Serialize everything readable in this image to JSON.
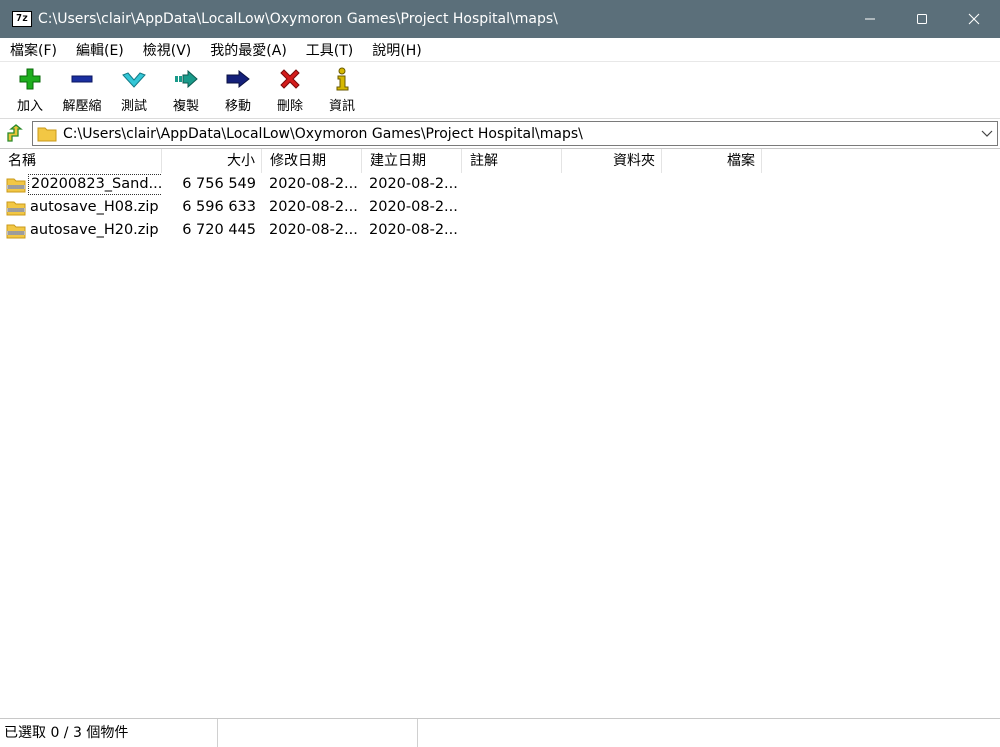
{
  "window": {
    "app_icon_text": "7z",
    "title": "C:\\Users\\clair\\AppData\\LocalLow\\Oxymoron Games\\Project Hospital\\maps\\"
  },
  "menu": [
    {
      "label": "檔案(F)"
    },
    {
      "label": "編輯(E)"
    },
    {
      "label": "檢視(V)"
    },
    {
      "label": "我的最愛(A)"
    },
    {
      "label": "工具(T)"
    },
    {
      "label": "說明(H)"
    }
  ],
  "toolbar": [
    {
      "label": "加入",
      "icon": "plus-icon",
      "color": "#1fae1f"
    },
    {
      "label": "解壓縮",
      "icon": "minus-icon",
      "color": "#1a2fa0"
    },
    {
      "label": "測試",
      "icon": "check-icon",
      "color": "#33c6d6"
    },
    {
      "label": "複製",
      "icon": "copy-arrow-icon",
      "color": "#1a9a8a"
    },
    {
      "label": "移動",
      "icon": "move-arrow-icon",
      "color": "#14207a"
    },
    {
      "label": "刪除",
      "icon": "delete-x-icon",
      "color": "#d41c1c"
    },
    {
      "label": "資訊",
      "icon": "info-icon",
      "color": "#d6b800"
    }
  ],
  "address": {
    "path": "C:\\Users\\clair\\AppData\\LocalLow\\Oxymoron Games\\Project Hospital\\maps\\"
  },
  "columns": {
    "name": "名稱",
    "size": "大小",
    "modified": "修改日期",
    "created": "建立日期",
    "comment": "註解",
    "folders": "資料夾",
    "files": "檔案"
  },
  "files": [
    {
      "name": "20200823_Sand...",
      "size": "6 756 549",
      "modified": "2020-08-2...",
      "created": "2020-08-2..."
    },
    {
      "name": "autosave_H08.zip",
      "size": "6 596 633",
      "modified": "2020-08-2...",
      "created": "2020-08-2..."
    },
    {
      "name": "autosave_H20.zip",
      "size": "6 720 445",
      "modified": "2020-08-2...",
      "created": "2020-08-2..."
    }
  ],
  "status": {
    "selection": "已選取 0 / 3 個物件"
  }
}
